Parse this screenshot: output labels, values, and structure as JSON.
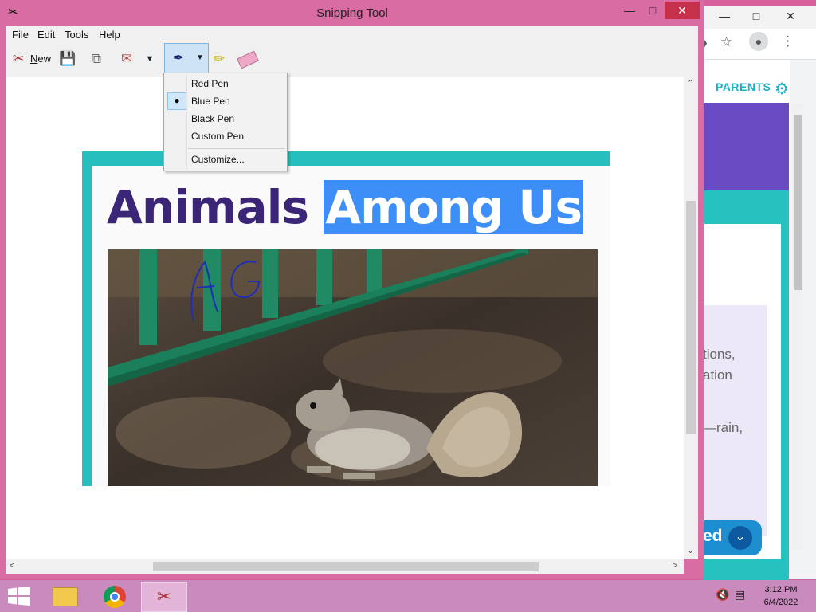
{
  "window": {
    "title": "Snipping Tool",
    "minimize": "—",
    "maximize": "□",
    "close": "✕"
  },
  "menubar": {
    "items": [
      "File",
      "Edit",
      "Tools",
      "Help"
    ]
  },
  "toolbar": {
    "new_label": "New",
    "icons": [
      "scissors-icon",
      "save-icon",
      "copy-icon",
      "send-email-icon",
      "dropdown-arrow-icon",
      "pen-icon",
      "highlighter-icon",
      "eraser-icon"
    ]
  },
  "pen_menu": {
    "items": [
      "Red Pen",
      "Blue Pen",
      "Black Pen",
      "Custom Pen"
    ],
    "selected": "Blue Pen",
    "customize": "Customize..."
  },
  "snip": {
    "headline_part1": "Animals",
    "headline_part2": "Among Us",
    "annotation_text": "AG"
  },
  "browser": {
    "parents": "PARENTS",
    "text_lines": [
      "tions,",
      "ation",
      "—rain,"
    ],
    "button_text": "ed"
  },
  "taskbar": {
    "time": "3:12 PM",
    "date": "6/4/2022"
  },
  "colors": {
    "window_frame": "#d96ca2",
    "close_button": "#c7304b",
    "highlight": "#3e8ef7",
    "headline": "#3a2577",
    "teal": "#26bfbd",
    "purple": "#6a4bc4",
    "taskbar": "#c98bbd"
  }
}
